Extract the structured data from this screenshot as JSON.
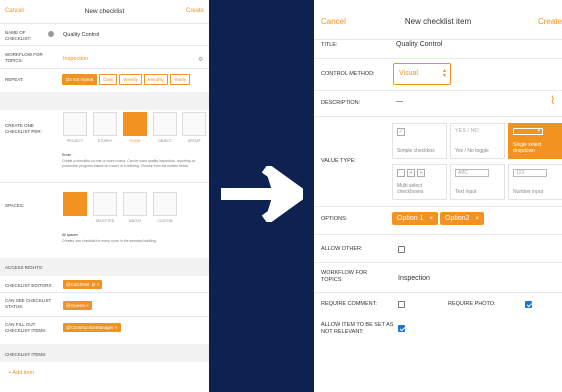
{
  "left": {
    "header": {
      "cancel": "Cancel",
      "title": "New checklist",
      "create": "Create"
    },
    "name_label": "NAME OF CHECKLIST:",
    "name_value": "Quality Control",
    "workflow_label": "WORKFLOW FOR TOPICS:",
    "workflow_value": "Inspection",
    "repeat_label": "REPEAT:",
    "repeat_options": [
      "Do not repeat",
      "Daily",
      "Weekly",
      "Monthly",
      "Yearly"
    ],
    "create_per_label": "CREATE ONE CHECKLIST PER:",
    "create_per_options": [
      "PROJECT",
      "STOREY",
      "ROOM",
      "OBJECT",
      "GROUP"
    ],
    "create_per_desc_title": "Room",
    "create_per_desc": "Create a checklist on one or more rooms. Can be used quality inspection, reporting on production progress based on rooms in a building. Choose from the modes below.",
    "spaces_label": "SPACES:",
    "spaces_options": [
      "ALL",
      "SELECTED",
      "MATCH",
      "CUSTOM"
    ],
    "spaces_desc_title": "All spaces",
    "spaces_desc": "Creates one checklist for every room in the selected building.",
    "access_header": "ACCESS RIGHTS:",
    "editors_label": "CHECKLIST EDITORS:",
    "editors_tag": "@CatchNet  pl",
    "status_label": "CAN SEE CHECKLIST STATUS:",
    "status_tag": "@Guests",
    "fill_label": "CAN FILL OUT CHECKLIST ITEMS:",
    "fill_tag": "@ConstructionManager",
    "items_header": "CHECKLIST ITEMS:",
    "add_item": "+ Add item"
  },
  "right": {
    "header": {
      "cancel": "Cancel",
      "title": "New checklist item",
      "create": "Create"
    },
    "title_label": "TITLE:",
    "title_value": "Quality Control",
    "method_label": "CONTROL METHOD:",
    "method_value": "Visual",
    "description_label": "DESCRIPTION:",
    "description_value": "—",
    "value_type_label": "VALUE TYPE:",
    "value_types": [
      {
        "label": "Simple checkbox"
      },
      {
        "label": "Yes / No toggle",
        "badge": "YES / NO"
      },
      {
        "label": "Single select dropdown"
      },
      {
        "label": "Multi select checkboxes"
      },
      {
        "label": "Text input",
        "badge": "ABC"
      },
      {
        "label": "Number input",
        "badge": "123"
      }
    ],
    "options_label": "OPTIONS:",
    "options": [
      "Option 1",
      "Option2"
    ],
    "allow_other_label": "ALLOW OTHER:",
    "workflow_label": "WORKFLOW FOR TOPICS:",
    "workflow_value": "Inspection",
    "require_comment_label": "REQUIRE COMMENT:",
    "require_photo_label": "REQUIRE PHOTO:",
    "not_relevant_label": "ALLOW ITEM TO BE SET AS NOT RELEVANT:"
  },
  "colors": {
    "accent": "#f29321",
    "background": "#0d2251",
    "checkbox": "#1976d2"
  }
}
